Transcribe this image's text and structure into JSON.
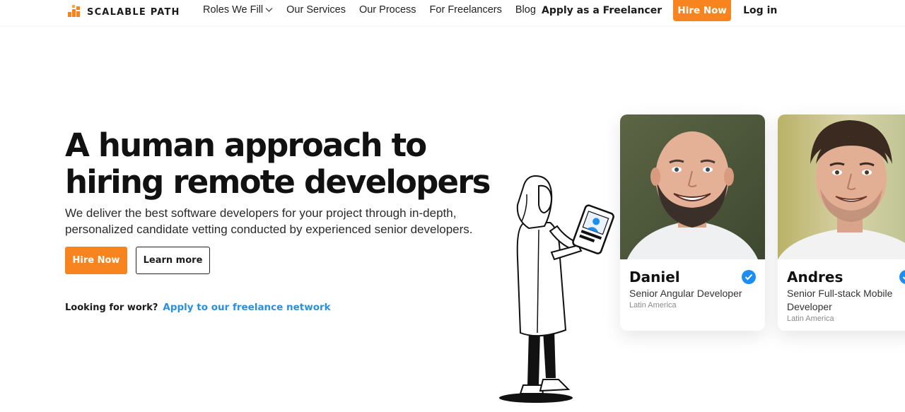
{
  "nav": {
    "logo_text": "SCALABLE PATH",
    "links": [
      {
        "label": "Roles We Fill",
        "has_dropdown": true
      },
      {
        "label": "Our Services",
        "has_dropdown": false
      },
      {
        "label": "Our Process",
        "has_dropdown": false
      },
      {
        "label": "For Freelancers",
        "has_dropdown": false
      },
      {
        "label": "Blog",
        "has_dropdown": false
      }
    ],
    "apply_label": "Apply as a Freelancer",
    "hire_label": "Hire Now",
    "login_label": "Log in"
  },
  "hero": {
    "title_line1": "A human approach to",
    "title_line2": "hiring remote developers",
    "subtitle_line1": "We deliver the best software developers for your project through in-depth,",
    "subtitle_line2": "personalized candidate vetting conducted by experienced senior developers.",
    "hire_button": "Hire Now",
    "learn_button": "Learn more",
    "work_question": "Looking for work?",
    "work_link": "Apply to our freelance network"
  },
  "cards": [
    {
      "name": "Daniel",
      "role": "Senior Angular Developer",
      "region": "Latin America",
      "verified": true
    },
    {
      "name": "Andres",
      "role": "Senior Full-stack Mobile Developer",
      "region": "Latin America",
      "verified": true
    }
  ],
  "colors": {
    "accent": "#f7841e",
    "link": "#2a8fde",
    "verified": "#1b8ef0"
  },
  "icons": [
    "logo-bars-icon",
    "chevron-down-icon",
    "verified-check-icon"
  ]
}
